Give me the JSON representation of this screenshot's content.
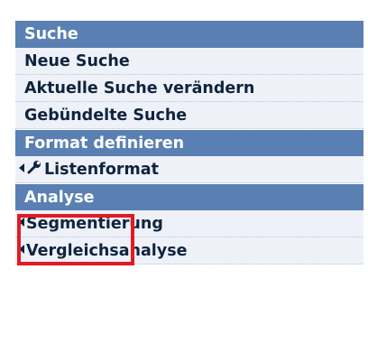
{
  "menu": {
    "sections": [
      {
        "title": "Suche",
        "items": [
          {
            "label": "Neue Suche"
          },
          {
            "label": "Aktuelle Suche verändern"
          },
          {
            "label": "Gebündelte Suche"
          }
        ]
      },
      {
        "title": "Format definieren",
        "items": [
          {
            "label": "Listenformat",
            "icon": "wrench-icon"
          }
        ]
      },
      {
        "title": "Analyse",
        "items": [
          {
            "label": "Segmentierung",
            "icon": "arrow-left-icon"
          },
          {
            "label": "Vergleichsanalyse",
            "icon": "arrow-left-icon"
          }
        ]
      }
    ]
  },
  "highlight": {
    "target": "Analyse",
    "color": "#e21b23"
  },
  "colors": {
    "section_bg": "#5a80b3",
    "item_bg": "#eef2f8",
    "item_text": "#10243f"
  }
}
